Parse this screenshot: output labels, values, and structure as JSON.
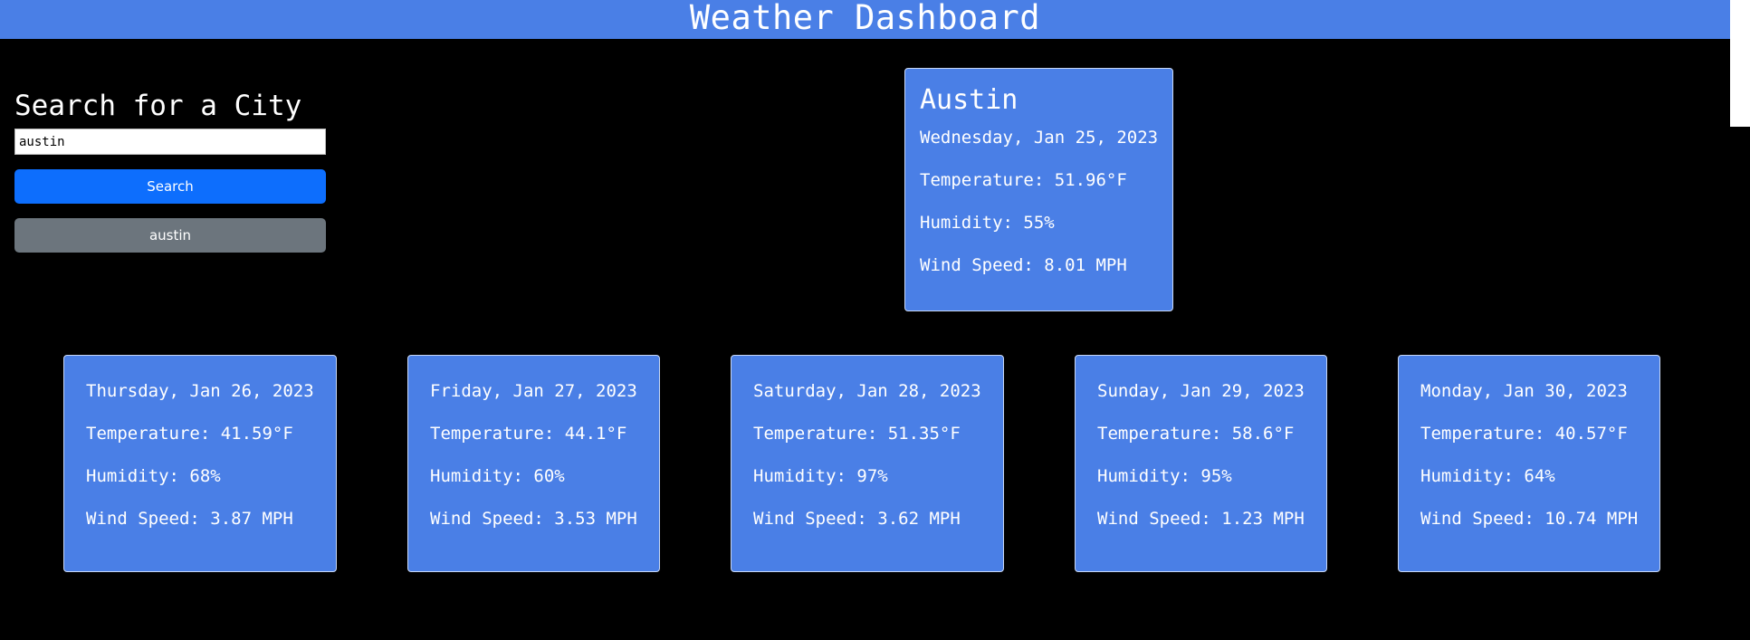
{
  "header": {
    "title": "Weather Dashboard"
  },
  "search": {
    "heading": "Search for a City",
    "input_value": "austin",
    "button_label": "Search",
    "history": [
      "austin"
    ]
  },
  "current": {
    "city": "Austin",
    "date": "Wednesday, Jan 25, 2023",
    "temperature": "Temperature: 51.96°F",
    "humidity": "Humidity: 55%",
    "wind": "Wind Speed: 8.01 MPH"
  },
  "forecast": [
    {
      "date": "Thursday, Jan 26, 2023",
      "temperature": "Temperature: 41.59°F",
      "humidity": "Humidity: 68%",
      "wind": "Wind Speed: 3.87 MPH"
    },
    {
      "date": "Friday, Jan 27, 2023",
      "temperature": "Temperature: 44.1°F",
      "humidity": "Humidity: 60%",
      "wind": "Wind Speed: 3.53 MPH"
    },
    {
      "date": "Saturday, Jan 28, 2023",
      "temperature": "Temperature: 51.35°F",
      "humidity": "Humidity: 97%",
      "wind": "Wind Speed: 3.62 MPH"
    },
    {
      "date": "Sunday, Jan 29, 2023",
      "temperature": "Temperature: 58.6°F",
      "humidity": "Humidity: 95%",
      "wind": "Wind Speed: 1.23 MPH"
    },
    {
      "date": "Monday, Jan 30, 2023",
      "temperature": "Temperature: 40.57°F",
      "humidity": "Humidity: 64%",
      "wind": "Wind Speed: 10.74 MPH"
    }
  ],
  "colors": {
    "header_bg": "#4a7fe6",
    "card_bg": "#4a7fe6",
    "search_button": "#0d6efd",
    "history_button": "#6c757d",
    "page_bg": "#000000"
  }
}
